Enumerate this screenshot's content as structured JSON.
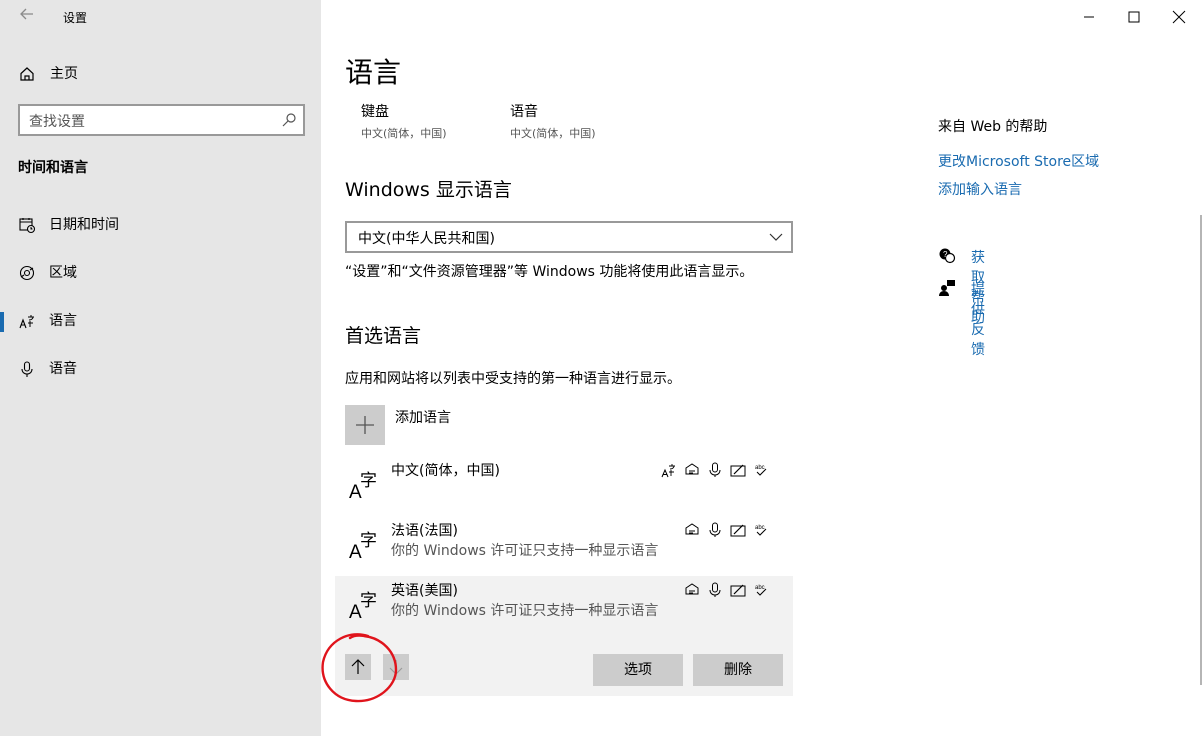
{
  "window": {
    "title": "设置"
  },
  "nav": {
    "home_label": "主页",
    "search_placeholder": "查找设置",
    "section_title": "时间和语言",
    "items": [
      {
        "label": "日期和时间",
        "icon": "calendar-clock-icon"
      },
      {
        "label": "区域",
        "icon": "globe-icon"
      },
      {
        "label": "语言",
        "icon": "language-icon",
        "active": true
      },
      {
        "label": "语音",
        "icon": "microphone-icon"
      }
    ]
  },
  "main": {
    "page_title": "语言",
    "status": [
      {
        "title": "键盘",
        "subtitle": "中文(简体，中国)"
      },
      {
        "title": "语音",
        "subtitle": "中文(简体，中国)"
      }
    ],
    "display_language": {
      "heading": "Windows 显示语言",
      "selected": "中文(中华人民共和国)",
      "note": "“设置”和“文件资源管理器”等 Windows 功能将使用此语言显示。"
    },
    "preferred": {
      "heading": "首选语言",
      "note": "应用和网站将以列表中受支持的第一种语言进行显示。",
      "add_label": "添加语言",
      "languages": [
        {
          "name": "中文(简体，中国)",
          "subtitle": ""
        },
        {
          "name": "法语(法国)",
          "subtitle": "你的 Windows 许可证只支持一种显示语言"
        },
        {
          "name": "英语(美国)",
          "subtitle": "你的 Windows 许可证只支持一种显示语言"
        }
      ],
      "options_label": "选项",
      "remove_label": "删除"
    }
  },
  "help": {
    "title": "来自 Web 的帮助",
    "links": [
      "更改Microsoft Store区域",
      "添加输入语言"
    ],
    "get_help": "获取帮助",
    "feedback": "提供反馈"
  },
  "colors": {
    "accent": "#1a6bb0",
    "nav_bg": "#e6e6e6",
    "button_bg": "#cccccc",
    "annotation": "#e0141c"
  }
}
